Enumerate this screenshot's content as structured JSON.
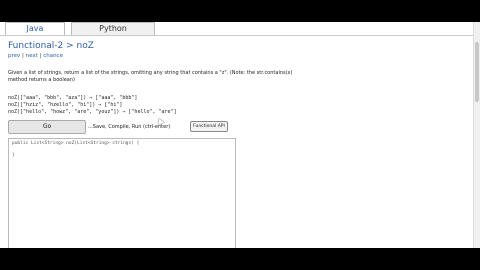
{
  "tabs": [
    {
      "label": "Java",
      "active": true
    },
    {
      "label": "Python",
      "active": false
    }
  ],
  "problem": {
    "title": "Functional-2 > noZ",
    "nav": {
      "prev": "prev",
      "next": "next",
      "chance": "chance"
    },
    "description": "Given a list of strings, return a list of the strings, omitting any string that contains a \"z\". (Note: the str.contains(x) method returns a boolean)",
    "examples": [
      "noZ([\"aaa\", \"bbb\", \"aza\"]) → [\"aaa\", \"bbb\"]",
      "noZ([\"hziz\", \"hzello\", \"hi\"]) → [\"hi\"]",
      "noZ([\"hello\", \"howz\", \"are\", \"youz\"]) → [\"hello\", \"are\"]"
    ]
  },
  "toolbar": {
    "go_label": "Go",
    "run_hint": "...Save, Compile, Run (ctrl-enter)",
    "api_label": "Functional API"
  },
  "editor": {
    "code": "public List<String> noZ(List<String> strings) {\n  \n}"
  },
  "colors": {
    "link": "#2b5fa8",
    "frame": "#000000"
  }
}
